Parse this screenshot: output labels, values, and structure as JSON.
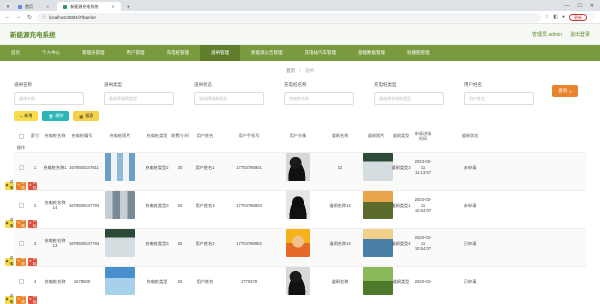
{
  "browser": {
    "tabs": [
      {
        "label": "首页",
        "active": false
      },
      {
        "label": "新能源充电系统",
        "active": true
      }
    ],
    "url": "localhost:8081/#/barrier",
    "update_label": "更新"
  },
  "header": {
    "title": "新能源充电系统",
    "user": "管理员 admin",
    "logout": "退出登录"
  },
  "menu": [
    {
      "label": "首页",
      "active": false
    },
    {
      "label": "个人中心",
      "active": false
    },
    {
      "label": "管理员管理",
      "active": false
    },
    {
      "label": "用户管理",
      "active": false
    },
    {
      "label": "充电桩管理",
      "active": false
    },
    {
      "label": "道闸管理",
      "active": true
    },
    {
      "label": "新能源公告管理",
      "active": false
    },
    {
      "label": "充电站汽车管理",
      "active": false
    },
    {
      "label": "基础数据管理",
      "active": false
    },
    {
      "label": "轮播图管理",
      "active": false
    }
  ],
  "breadcrumb": {
    "home": "首页",
    "current": "道闸"
  },
  "search": {
    "fields": [
      {
        "label": "道闸名称",
        "placeholder": "道闸名称"
      },
      {
        "label": "道闸类型",
        "placeholder": "请选择道闸类型"
      },
      {
        "label": "道闸状态",
        "placeholder": "请选择道闸状态"
      },
      {
        "label": "充电桩名称",
        "placeholder": "充电桩名称"
      },
      {
        "label": "充电桩类型",
        "placeholder": "请选择充电桩类型"
      },
      {
        "label": "用户姓名",
        "placeholder": "用户姓名"
      }
    ],
    "query_label": "查询"
  },
  "actions": {
    "add": "新增",
    "delete": "删除",
    "report": "报表"
  },
  "table": {
    "headers": [
      "索引",
      "充电桩名称",
      "充电桩编号",
      "充电桩照片",
      "充电桩类型",
      "收费/小时",
      "用户姓名",
      "用户手机号",
      "用户头像",
      "道闸名称",
      "道闸照片",
      "道闸类型",
      "申请进场时间",
      "道闸状态",
      "操作"
    ],
    "rows": [
      {
        "index": "1",
        "name": "充电桩名称1",
        "code": "1678500247811",
        "type": "充电桩类型2",
        "fee": "20",
        "user": "用户姓名1",
        "phone": "17703786901",
        "barrier": "22",
        "btype": "道闸类型3",
        "time": "2023-03-11 11:13:57",
        "status": "未申请"
      },
      {
        "index": "2",
        "name": "充电桩名称14",
        "code": "1678500247793",
        "type": "充电桩类型3",
        "fee": "20",
        "user": "用户姓名3",
        "phone": "17703786903",
        "barrier": "道闸名称14",
        "btype": "道闸类型1",
        "time": "2023-03-11 10:54:07",
        "status": "未申请"
      },
      {
        "index": "3",
        "name": "充电桩名称13",
        "code": "1678500247784",
        "type": "充电桩类型3",
        "fee": "20",
        "user": "用户姓名2",
        "phone": "17703786902",
        "barrier": "道闸名称13",
        "btype": "道闸类型4",
        "time": "2023-03-11 10:54:07",
        "status": "已申请"
      },
      {
        "index": "4",
        "name": "充电桩名称",
        "code": "1678500",
        "type": "充电桩类型",
        "fee": "20",
        "user": "用户姓名",
        "phone": "1770378",
        "barrier": "道闸名称",
        "btype": "道闸类型",
        "time": "2023-03-",
        "status": "已申请"
      }
    ],
    "row_actions": {
      "view": "详情",
      "edit": "修改",
      "delete": "删除"
    }
  },
  "colors": {
    "brand": "#5d8a2f",
    "menu": "#7a9a3f",
    "query": "#e9842d"
  }
}
